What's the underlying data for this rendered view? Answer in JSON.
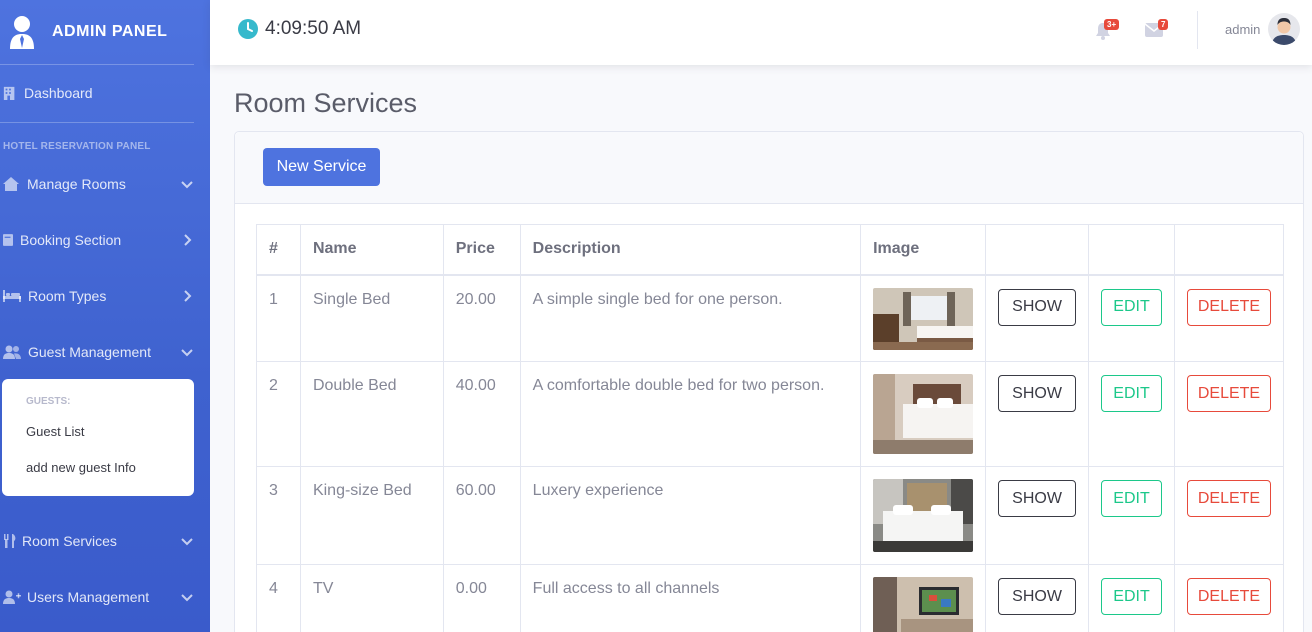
{
  "brand": {
    "title": "ADMIN PANEL"
  },
  "sidebar": {
    "dashboard": "Dashboard",
    "heading": "HOTEL RESERVATION PANEL",
    "items": [
      {
        "label": "Manage Rooms",
        "chevron": "down",
        "icon": "hotel-icon"
      },
      {
        "label": "Booking Section",
        "chevron": "right",
        "icon": "book-icon"
      },
      {
        "label": "Room Types",
        "chevron": "right",
        "icon": "bed-icon"
      },
      {
        "label": "Guest Management",
        "chevron": "down",
        "icon": "users-icon"
      },
      {
        "label": "Room Services",
        "chevron": "down",
        "icon": "utensils-icon"
      },
      {
        "label": "Users Management",
        "chevron": "down",
        "icon": "user-plus-icon"
      }
    ],
    "guests_menu": {
      "heading": "GUESTS:",
      "links": [
        "Guest List",
        "add new guest Info"
      ]
    }
  },
  "topbar": {
    "time": "4:09:50 AM",
    "alerts_badge": "3+",
    "messages_badge": "7",
    "user_name": "admin"
  },
  "page": {
    "title": "Room Services",
    "new_button": "New Service"
  },
  "table": {
    "headers": [
      "#",
      "Name",
      "Price",
      "Description",
      "Image",
      "",
      "",
      ""
    ],
    "actions": {
      "show": "SHOW",
      "edit": "EDIT",
      "delete": "DELETE"
    },
    "rows": [
      {
        "id": "1",
        "name": "Single Bed",
        "price": "20.00",
        "description": "A simple single bed for one person."
      },
      {
        "id": "2",
        "name": "Double Bed",
        "price": "40.00",
        "description": "A comfortable double bed for two person."
      },
      {
        "id": "3",
        "name": "King-size Bed",
        "price": "60.00",
        "description": "Luxery experience"
      },
      {
        "id": "4",
        "name": "TV",
        "price": "0.00",
        "description": "Full access to all channels"
      }
    ]
  },
  "colors": {
    "primary": "#4e73df",
    "success": "#1cc88a",
    "danger": "#e74a3b",
    "dark": "#3a3b45",
    "clock": "#36b9cc"
  }
}
